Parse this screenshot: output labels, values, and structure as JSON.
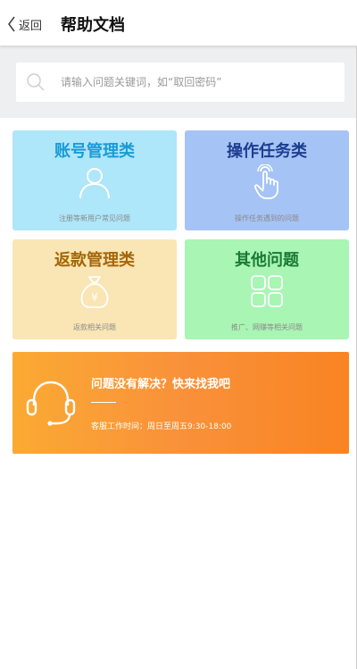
{
  "header": {
    "back_label": "返回",
    "title": "帮助文档"
  },
  "search": {
    "placeholder": "请输入问题关键词，如“取回密码”"
  },
  "categories": [
    {
      "title": "账号管理类",
      "desc": "注册等新用户常见问题",
      "icon": "user-icon",
      "color": "#1a9bd6",
      "bg": "#aee6fa"
    },
    {
      "title": "操作任务类",
      "desc": "操作任务遇到的问题",
      "icon": "pointer-hand-icon",
      "color": "#1d3d8f",
      "bg": "#a6c3f5"
    },
    {
      "title": "返款管理类",
      "desc": "返款相关问题",
      "icon": "money-bag-icon",
      "color": "#a4660a",
      "bg": "#f9e6b4"
    },
    {
      "title": "其他问题",
      "desc": "推广、网赚等相关问题",
      "icon": "grid-icon",
      "color": "#1b7a35",
      "bg": "#a9f5b4"
    }
  ],
  "support": {
    "title": "问题没有解决？快来找我吧",
    "hours": "客服工作时间：周日至周五9:30-18:00",
    "icon": "headset-icon"
  },
  "colors": {
    "banner_gradient_start": "#fbaa33",
    "banner_gradient_end": "#f98422",
    "search_bg": "#eeeff1"
  }
}
